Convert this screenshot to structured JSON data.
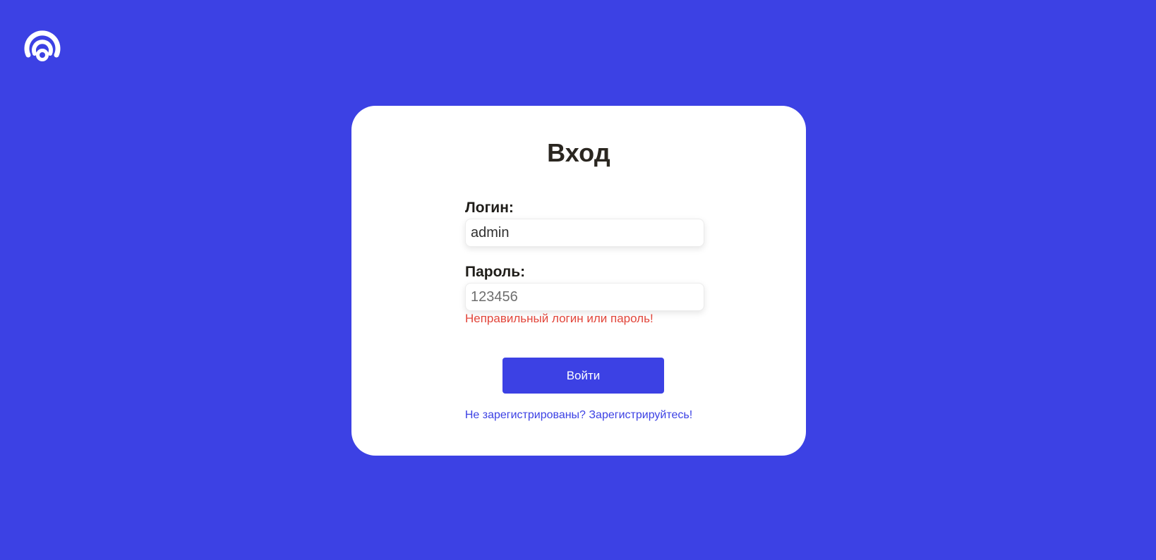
{
  "logo": {
    "icon": "wifi-signal-logo-icon",
    "color": "#ffffff"
  },
  "colors": {
    "background": "#3c41e4",
    "card": "#ffffff",
    "accent": "#3c41e4",
    "error": "#e2453a"
  },
  "login_form": {
    "title": "Вход",
    "login_label": "Логин:",
    "login_value": "admin",
    "password_label": "Пароль:",
    "password_value": "123456",
    "error_message": "Неправильный логин или пароль!",
    "submit_label": "Войти",
    "register_link": "Не зарегистрированы? Зарегистрируйтесь!"
  }
}
